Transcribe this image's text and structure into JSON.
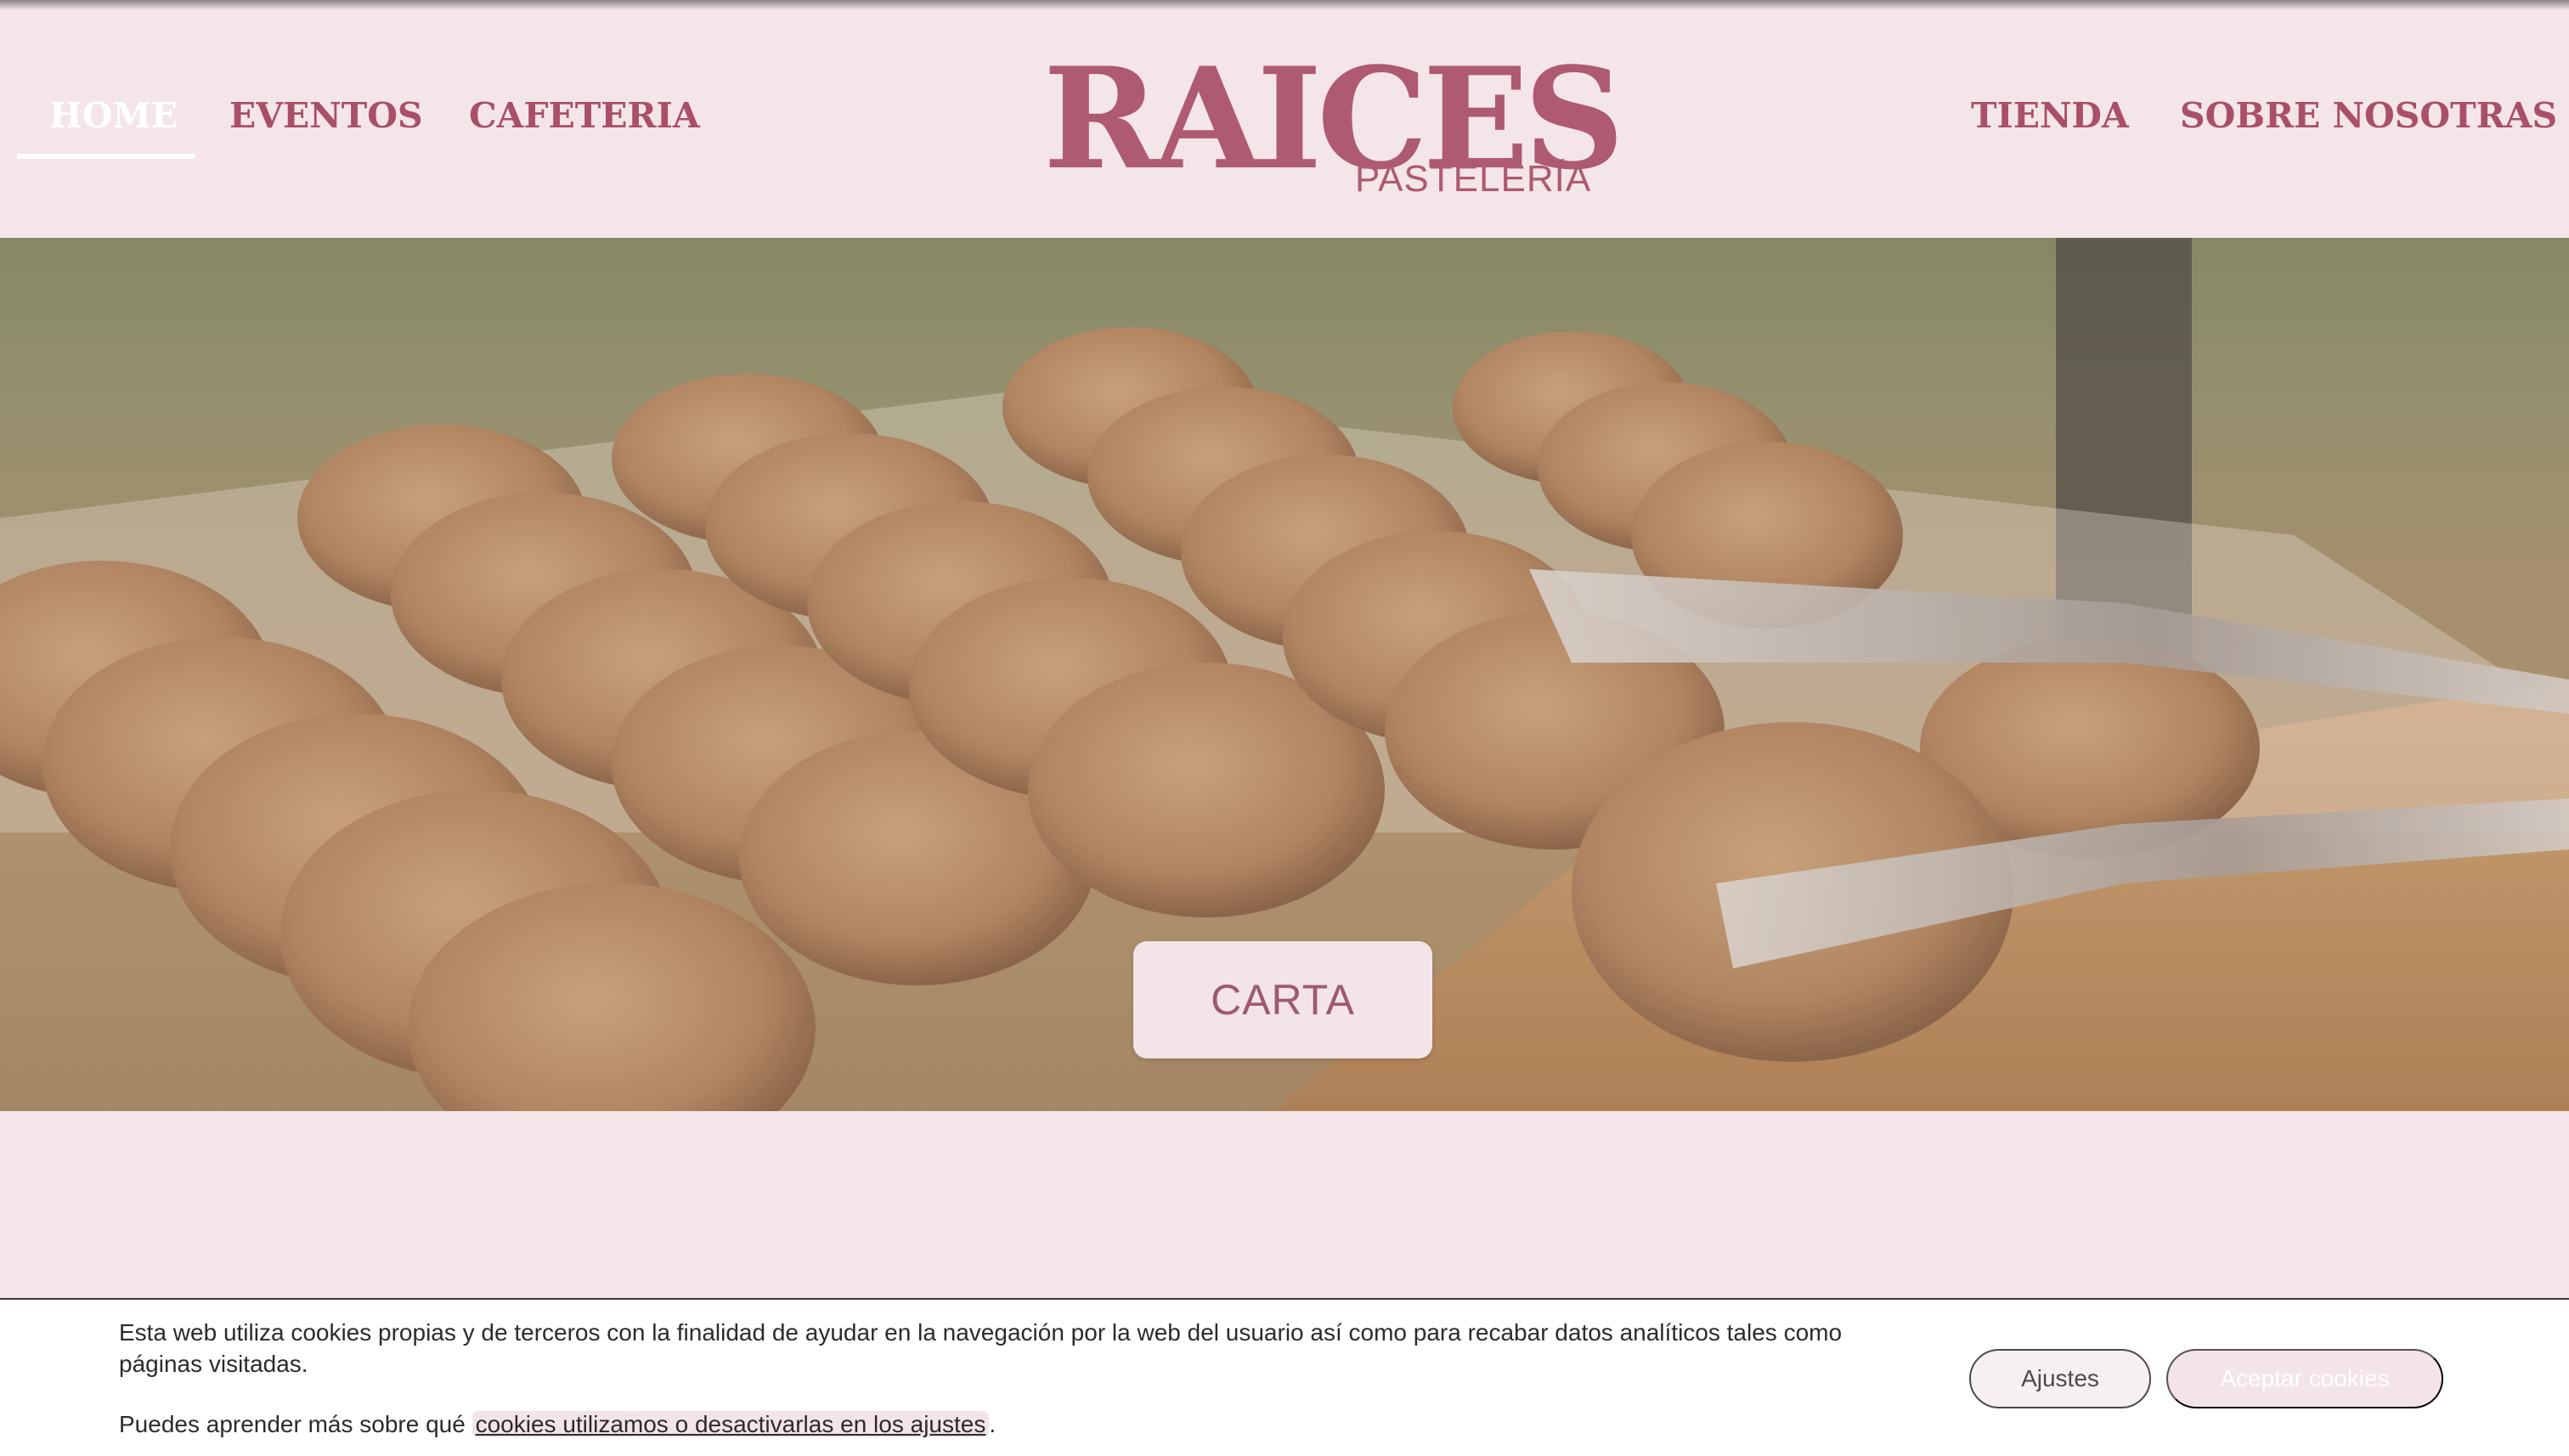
{
  "nav": {
    "left": [
      {
        "label": "HOME",
        "active": true
      },
      {
        "label": "EVENTOS",
        "active": false
      },
      {
        "label": "CAFETERIA",
        "active": false
      }
    ],
    "right": [
      {
        "label": "TIENDA"
      },
      {
        "label": "SOBRE NOSOTRAS"
      }
    ]
  },
  "logo": {
    "main": "RAICES",
    "sub": "PASTELERÍA"
  },
  "hero": {
    "image": "cookies-tray-photo",
    "cta_label": "CARTA"
  },
  "cookie_banner": {
    "text": "Esta web utiliza cookies propias y de terceros con la finalidad de ayudar en la navegación por la web del usuario así como para recabar datos analíticos tales como páginas visitadas.",
    "learn_prefix": "Puedes aprender más sobre qué ",
    "learn_link": "cookies utilizamos o desactivarlas en los ajustes",
    "learn_suffix": ".",
    "settings_label": "Ajustes",
    "accept_label": "Aceptar cookies"
  },
  "colors": {
    "background": "#f4e5e8",
    "brand": "#ae5a70",
    "nav_text": "#a94f68",
    "button_bg": "#f3e4e8"
  }
}
